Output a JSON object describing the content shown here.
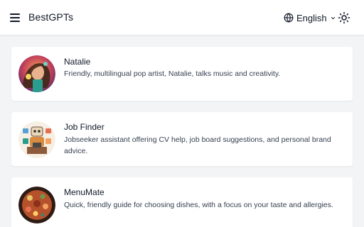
{
  "header": {
    "brand": "BestGPTs",
    "language": "English",
    "icons": {
      "menu": "hamburger-menu-icon",
      "globe": "globe-icon",
      "chevron": "chevron-down-icon",
      "theme": "sun-icon"
    }
  },
  "cards": [
    {
      "title": "Natalie",
      "description": "Friendly, multilingual pop artist, Natalie, talks music and creativity."
    },
    {
      "title": "Job Finder",
      "description": "Jobseeker assistant offering CV help, job board suggestions, and personal brand advice."
    },
    {
      "title": "MenuMate",
      "description": "Quick, friendly guide for choosing dishes, with a focus on your taste and allergies."
    }
  ],
  "colors": {
    "page_bg": "#f3f4f6",
    "card_bg": "#ffffff",
    "text": "#111827",
    "muted": "#374151"
  }
}
